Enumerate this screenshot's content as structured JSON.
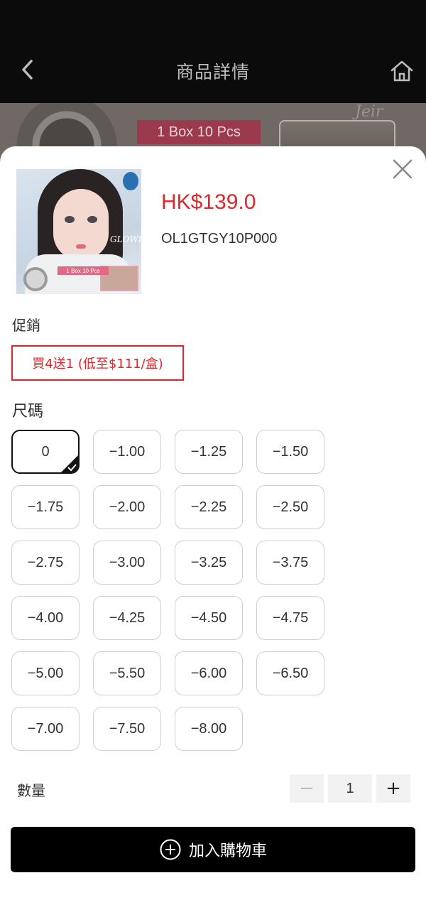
{
  "header": {
    "title": "商品詳情",
    "back_icon": "chevron-left-icon",
    "home_icon": "home-icon"
  },
  "banner": {
    "box_label": "1 Box 10 Pcs",
    "script_text": "Jeir"
  },
  "product": {
    "price": "HK$139.0",
    "sku": "OL1GTGY10P000",
    "image_tag": "1 Box 10 Pcs",
    "image_brand": "GLOWE"
  },
  "promotion": {
    "label": "促銷",
    "offer": "買4送1 (低至$111/盒)"
  },
  "size": {
    "label": "尺碼",
    "options": [
      "0",
      "−1.00",
      "−1.25",
      "−1.50",
      "−1.75",
      "−2.00",
      "−2.25",
      "−2.50",
      "−2.75",
      "−3.00",
      "−3.25",
      "−3.75",
      "−4.00",
      "−4.25",
      "−4.50",
      "−4.75",
      "−5.00",
      "−5.50",
      "−6.00",
      "−6.50",
      "−7.00",
      "−7.50",
      "−8.00"
    ],
    "selected": "0"
  },
  "quantity": {
    "label": "數量",
    "value": "1",
    "decrement": "−",
    "increment": "+"
  },
  "cart_button": {
    "label": "加入購物車"
  },
  "colors": {
    "accent_red": "#e0262b",
    "button_black": "#000000"
  }
}
